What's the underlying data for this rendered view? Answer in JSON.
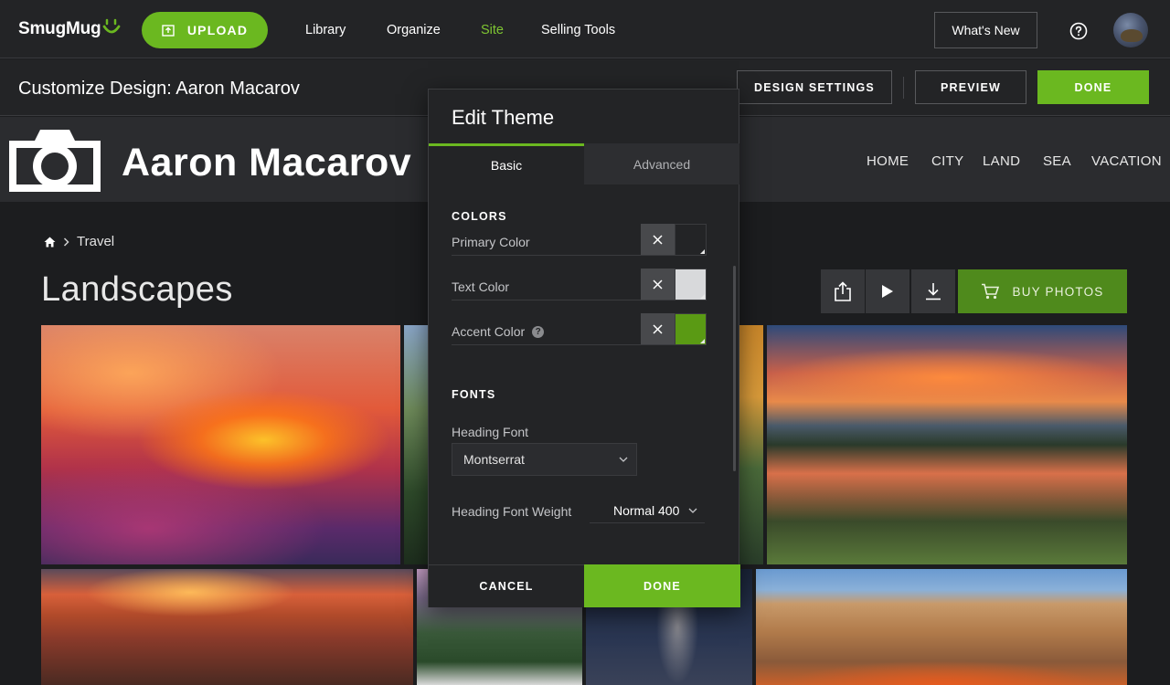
{
  "topnav": {
    "logo": "SmugMug",
    "upload_label": "UPLOAD",
    "links": [
      "Library",
      "Organize",
      "Site",
      "Selling Tools"
    ],
    "active_link": "Site",
    "whats_new_label": "What's New"
  },
  "customize": {
    "title": "Customize Design: Aaron Macarov",
    "design_settings_label": "DESIGN SETTINGS",
    "preview_label": "PREVIEW",
    "done_label": "DONE"
  },
  "site": {
    "name": "Aaron Macarov",
    "nav": [
      "HOME",
      "CITY",
      "LAND",
      "SEA",
      "VACATION"
    ]
  },
  "gallery": {
    "breadcrumb": "Travel",
    "title": "Landscapes",
    "buy_label": "BUY PHOTOS"
  },
  "edit_theme": {
    "title": "Edit Theme",
    "tabs": [
      "Basic",
      "Advanced"
    ],
    "active_tab": "Basic",
    "colors_section": "COLORS",
    "colors": [
      {
        "label": "Primary Color",
        "value": "#232426"
      },
      {
        "label": "Text Color",
        "value": "#d8d9db"
      },
      {
        "label": "Accent Color",
        "value": "#5a9a14"
      }
    ],
    "fonts_section": "FONTS",
    "heading_font_label": "Heading Font",
    "heading_font_value": "Montserrat",
    "heading_weight_label": "Heading Font Weight",
    "heading_weight_value": "Normal 400",
    "cancel_label": "CANCEL",
    "done_label": "DONE"
  },
  "colors": {
    "accent": "#6bb820",
    "background": "#1c1d1f"
  }
}
